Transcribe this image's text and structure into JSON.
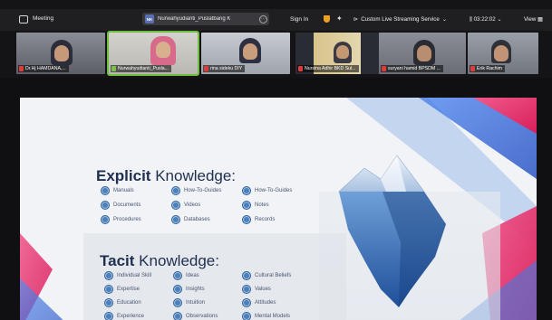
{
  "topbar": {
    "meeting_label": "Meeting",
    "speaker": {
      "initials": "NK",
      "name": "Nurwahyudianti_Puslatbang K"
    },
    "signin_label": "Sign In",
    "stream_label": "Custom Live Streaming Service",
    "timer": "03:22:02",
    "view_label": "View"
  },
  "participants": [
    {
      "name": "Dr.Hj HAMDANA,...",
      "active": false
    },
    {
      "name": "Nurwahyudianti_Pusla...",
      "active": true
    },
    {
      "name": "rina sideku DIY",
      "active": false
    },
    {
      "name": "Nursina Adhir BKD Sul...",
      "active": false
    },
    {
      "name": "suryani hamid BPSDM ...",
      "active": false
    },
    {
      "name": "Erik Rachim",
      "active": false
    }
  ],
  "slide": {
    "explicit": {
      "title_bold": "Explicit",
      "title_rest": " Knowledge:",
      "items": [
        "Manuals",
        "Documents",
        "Procedures",
        "How-To-Guides",
        "Videos",
        "Databases",
        "How-To-Guides",
        "Notes",
        "Records"
      ]
    },
    "tacit": {
      "title_bold": "Tacit",
      "title_rest": " Knowledge:",
      "items": [
        "Individual Skill",
        "Expertise",
        "Education",
        "Experience",
        "Ideas",
        "Insights",
        "Intuition",
        "Observations",
        "Cultural Beliefs",
        "Values",
        "Attitudes",
        "Mental Models"
      ]
    }
  },
  "colors": {
    "accent_pink": "#e8336f",
    "accent_blue": "#3c6fd6",
    "heading": "#1f2f4f",
    "bullet": "#4d7fb8"
  }
}
